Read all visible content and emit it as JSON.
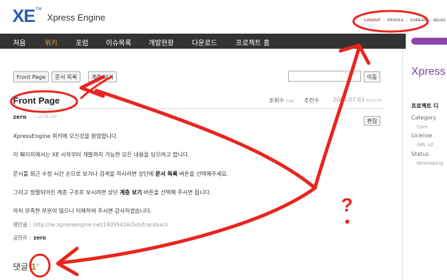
{
  "logo": {
    "mark": "XE",
    "tm": "TM",
    "text": "Xpress Engine"
  },
  "toplinks": {
    "logout": "LOGOUT",
    "profile": "PROFILE",
    "lang": "KOREAN",
    "select": "SELEC"
  },
  "nav": {
    "items": [
      "처음",
      "위키",
      "포럼",
      "이슈목록",
      "개발현황",
      "다운로드",
      "프로젝트 홈"
    ],
    "active_index": 1
  },
  "sidebar": {
    "logo": "Xpress",
    "title": "프로젝트 디",
    "category_label": "Category",
    "category_value": "Core",
    "license_label": "License",
    "license_value": "GPL v2",
    "status_label": "Status",
    "status_value": "developing"
  },
  "toolbar": {
    "front_page": "Front Page",
    "doc_list": "문서 목록",
    "hierarchy": "계층 보기",
    "search_button": "이동",
    "search_value": ""
  },
  "document": {
    "title": "Front Page",
    "views_label": "조회수",
    "views": "5160",
    "votes_label": "추천수",
    "date": "2009.07.03",
    "time": "04:01:24",
    "author": "zero",
    "ip": "*.13.26.107",
    "edit_button": "편집",
    "p1": "XpressEngine 위키에 오신것을 환영합니다.",
    "p2": "이 페이지에서는 XE 시작부터 개발까지 가능한 모든 내용을 담으려고 합니다.",
    "p3a": "문서를 최근 수정 시간 순으로 보거나 검색을 하시려면 상단에 ",
    "p3b": "문서 목록",
    "p3c": " 버튼을 선택해주세요.",
    "p4a": "그리고 정렬되어진 계층 구조로 보시려면 상단 ",
    "p4b": "계층 보기",
    "p4c": " 버튼을 선택해 주시면 됩니다.",
    "p5": "아직 부족한 부분이 많으니 이해하여 주시면 감사하겠습니다.",
    "trackback_label": "엮인글 :",
    "trackback_url": "http://xe.xpressengine.net/18095416/2eb/trackback",
    "contrib_label": "공헌자 :",
    "contrib_value": "zero"
  },
  "comments": {
    "label": "댓글",
    "count": "'1'"
  },
  "annotation": {
    "question": "?",
    "color": "#e8251e"
  }
}
